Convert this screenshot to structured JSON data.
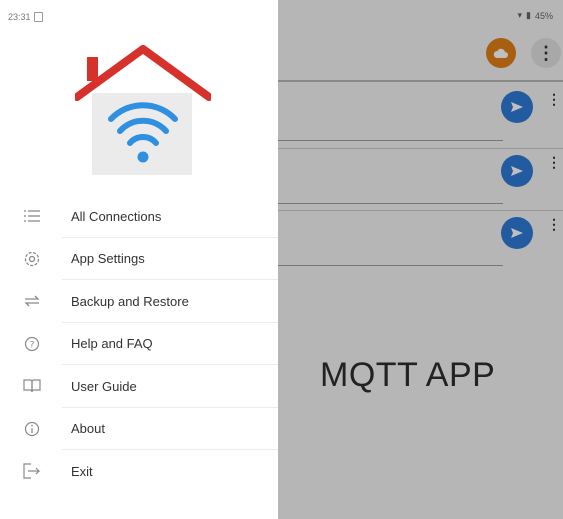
{
  "status_bar": {
    "time": "23:31",
    "battery": "45%"
  },
  "drawer": {
    "items": [
      {
        "label": "All Connections",
        "icon": "list-icon"
      },
      {
        "label": "App Settings",
        "icon": "gear-icon"
      },
      {
        "label": "Backup and Restore",
        "icon": "sync-icon"
      },
      {
        "label": "Help and FAQ",
        "icon": "help-icon"
      },
      {
        "label": "User Guide",
        "icon": "book-icon"
      },
      {
        "label": "About",
        "icon": "info-icon"
      },
      {
        "label": "Exit",
        "icon": "exit-icon"
      }
    ]
  },
  "overlay": {
    "app_name": "MQTT APP"
  },
  "colors": {
    "roof": "#d6312b",
    "wifi": "#2f8fe0",
    "fab_orange": "#e07f18",
    "send_blue": "#2f7ad6"
  }
}
